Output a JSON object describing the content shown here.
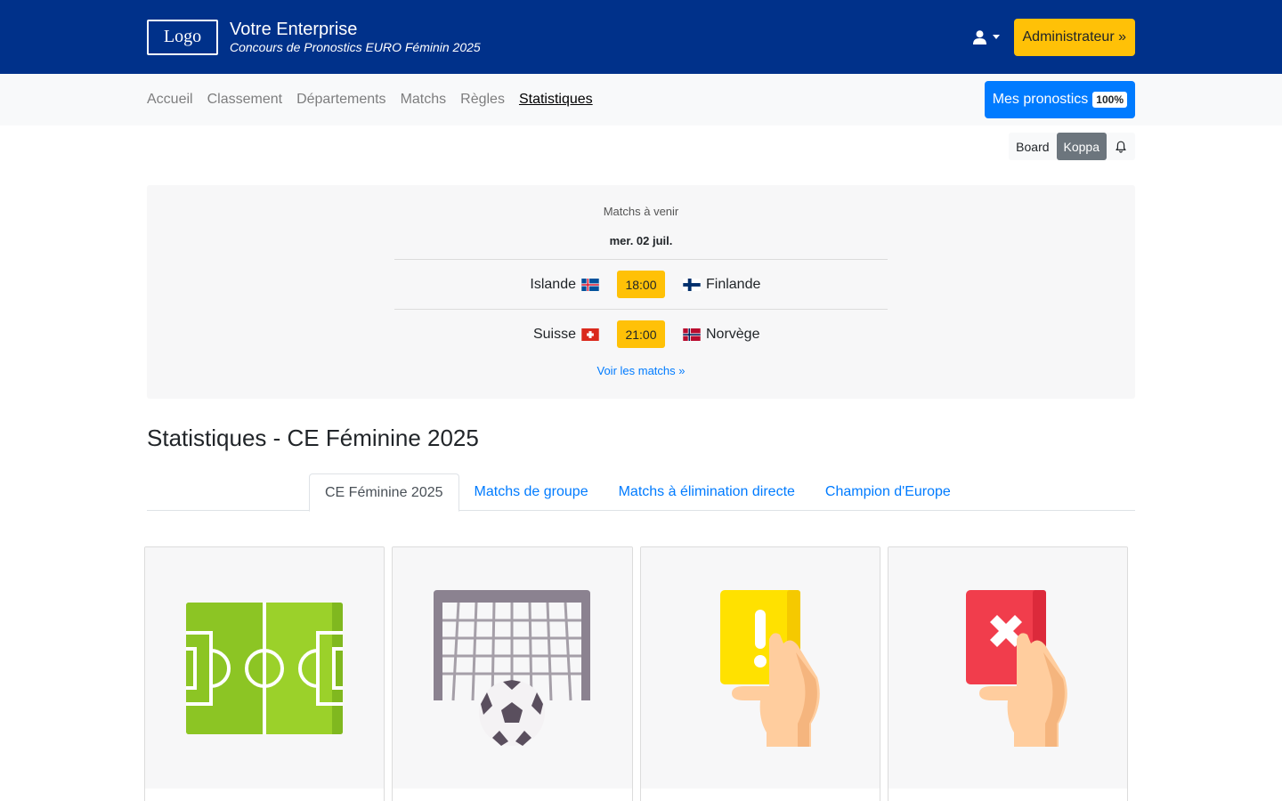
{
  "header": {
    "logo_text": "Logo",
    "brand_name": "Votre Enterprise",
    "brand_subtitle": "Concours de Pronostics EURO Féminin 2025",
    "user_icon": "user-icon",
    "admin_label": "Administrateur »"
  },
  "nav": {
    "items": [
      "Accueil",
      "Classement",
      "Départements",
      "Matchs",
      "Règles",
      "Statistiques"
    ],
    "active": "Statistiques",
    "mes_label": "Mes pronostics",
    "mes_badge": "100%"
  },
  "toolbar": {
    "board_label": "Board",
    "koppa_label": "Koppa",
    "bell_icon": "bell-icon"
  },
  "upcoming": {
    "title": "Matchs à venir",
    "date": "mer. 02 juil.",
    "matches": [
      {
        "home": "Islande",
        "home_flag": "iceland-flag",
        "time": "18:00",
        "away": "Finlande",
        "away_flag": "finland-flag"
      },
      {
        "home": "Suisse",
        "home_flag": "switzerland-flag",
        "time": "21:00",
        "away": "Norvège",
        "away_flag": "norway-flag"
      }
    ],
    "link": "Voir les matchs »"
  },
  "page": {
    "title": "Statistiques - CE Féminine 2025"
  },
  "tabs": [
    "CE Féminine 2025",
    "Matchs de groupe",
    "Matchs à élimination directe",
    "Champion d'Europe"
  ],
  "cards": [
    {
      "icon": "football-pitch-icon"
    },
    {
      "icon": "goal-net-ball-icon"
    },
    {
      "icon": "yellow-card-icon"
    },
    {
      "icon": "red-card-icon"
    }
  ],
  "colors": {
    "header_bg": "#00318a",
    "accent_yellow": "#ffc107",
    "primary_blue": "#007bff"
  }
}
